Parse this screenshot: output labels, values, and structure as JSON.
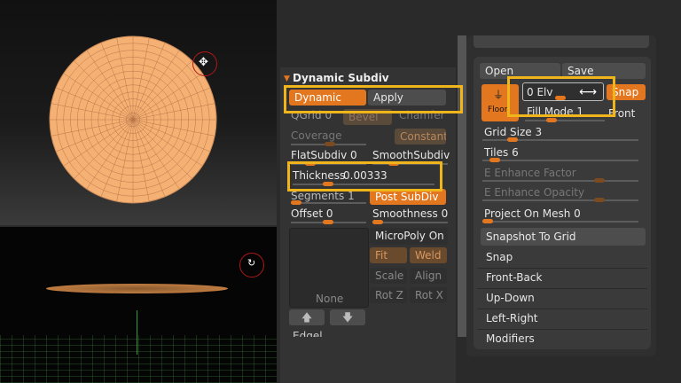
{
  "left_panel": {
    "header": "Dynamic Subdiv",
    "dynamic_label": "Dynamic",
    "apply_label": "Apply",
    "qgrid_label": "QGrid 0",
    "bevel_label": "Bevel",
    "chamfer_label": "Chamfer",
    "coverage_label": "Coverage",
    "constant_label": "Constant",
    "flatsubdiv_label": "FlatSubdiv 0",
    "smoothsubdiv_label": "SmoothSubdiv",
    "thickness_label": "Thickness",
    "thickness_value": "0.00333",
    "segments_label": "Segments 1",
    "post_subdiv_label": "Post SubDiv",
    "offset_label": "Offset 0",
    "smoothness_label": "Smoothness 0",
    "micropoly_label": "MicroPoly On",
    "none_label": "None",
    "fit_label": "Fit",
    "weld_label": "Weld",
    "scale_label": "Scale",
    "align_label": "Align",
    "rotz_label": "Rot Z",
    "rotx_label": "Rot X",
    "bottom_cut_label": "Edgel..."
  },
  "right_panel": {
    "open_label": "Open",
    "save_label": "Save",
    "floor_label": "Floor",
    "elv_label": "0 Elv",
    "snap_label": "Snap",
    "fill_mode_label": "Fill Mode 1",
    "front_label": "Front",
    "grid_size_label": "Grid Size 3",
    "tiles_label": "Tiles 6",
    "e_enhance_factor_label": "E Enhance Factor",
    "e_enhance_opacity_label": "E Enhance Opacity",
    "project_on_mesh_label": "Project On Mesh 0",
    "snapshot_to_grid_label": "Snapshot To Grid",
    "menu_items": [
      "Snap",
      "Front-Back",
      "Up-Down",
      "Left-Right",
      "Modifiers"
    ]
  },
  "colors": {
    "accent": "#e3771f",
    "highlight": "#f0b51a",
    "disc": "#f5b173"
  }
}
